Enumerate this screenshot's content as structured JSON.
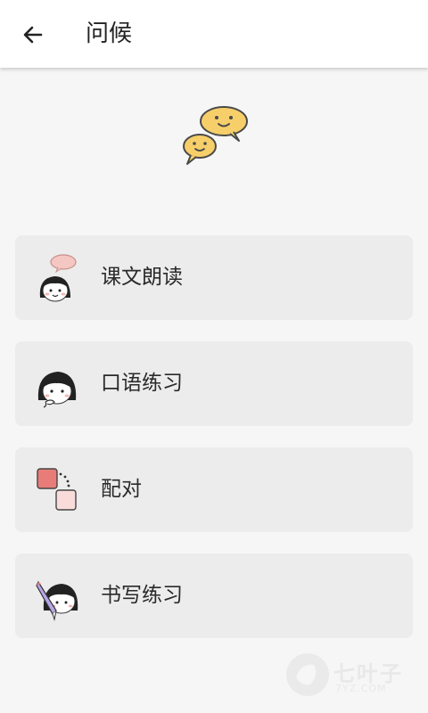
{
  "header": {
    "title": "问候"
  },
  "menu": {
    "items": [
      {
        "label": "课文朗读",
        "icon": "girl-speech-bubble-icon"
      },
      {
        "label": "口语练习",
        "icon": "girl-speaking-icon"
      },
      {
        "label": "配对",
        "icon": "matching-cards-icon"
      },
      {
        "label": "书写练习",
        "icon": "girl-pen-icon"
      }
    ]
  },
  "watermark": {
    "text": "七叶子",
    "sub": "7YZ.COM"
  },
  "colors": {
    "bubble_yellow": "#f7cf6a",
    "card_bg": "#ececec",
    "pink": "#f4c7c2",
    "red_card": "#e87c78"
  }
}
